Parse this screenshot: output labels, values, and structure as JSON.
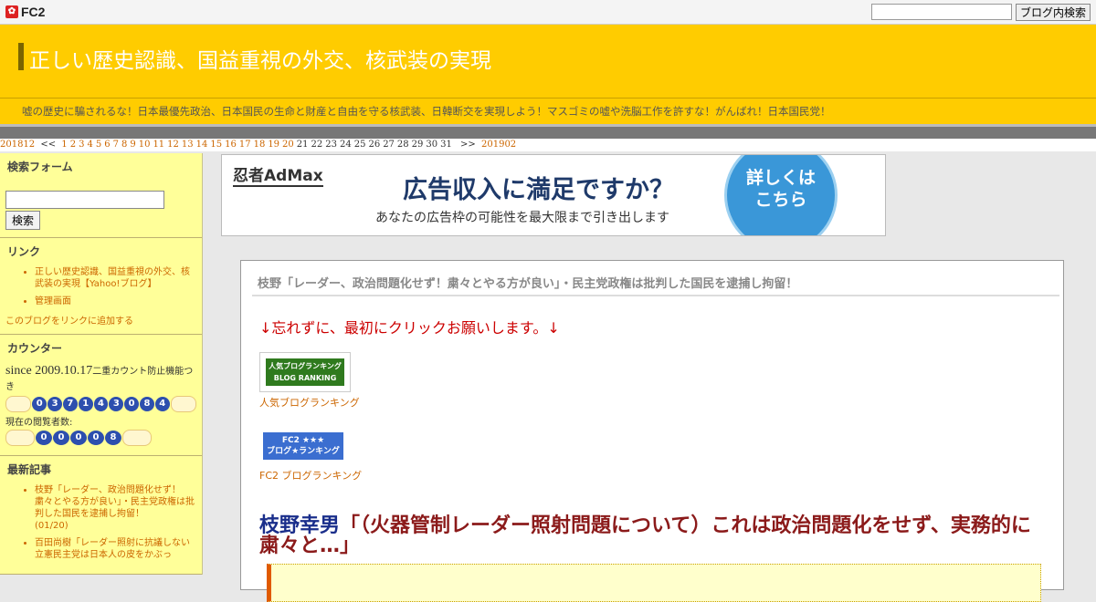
{
  "fc2bar": {
    "logo_text": "FC2",
    "search_placeholder": "",
    "search_button": "ブログ内検索"
  },
  "header": {
    "title": "正しい歴史認識、国益重視の外交、核武装の実現",
    "description": "嘘の歴史に騙されるな！日本最優先政治、日本国民の生命と財産と自由を守る核武装、日韓断交を実現しよう！マスゴミの嘘や洗脳工作を許すな！がんばれ！日本国民党！"
  },
  "calendar": {
    "prev_month": "201812",
    "prev_arrow": "<<",
    "linked_days": [
      "1",
      "2",
      "3",
      "4",
      "5",
      "6",
      "7",
      "8",
      "9",
      "10",
      "11",
      "12",
      "13",
      "14",
      "15",
      "16",
      "17",
      "18",
      "19",
      "20"
    ],
    "plain_days": [
      "21",
      "22",
      "23",
      "24",
      "25",
      "26",
      "27",
      "28",
      "29",
      "30",
      "31"
    ],
    "next_arrow": ">>",
    "next_month": "201902"
  },
  "sidebar": {
    "search": {
      "title": "検索フォーム",
      "button": "検索"
    },
    "links": {
      "title": "リンク",
      "items": [
        "正しい歴史認識、国益重視の外交、核武装の実現【Yahoo!ブログ】",
        "管理画面"
      ],
      "add": "このブログをリンクに追加する"
    },
    "counter": {
      "title": "カウンター",
      "since": "since 2009.10.17",
      "note": "二重カウント防止機能つき",
      "total_digits": [
        "0",
        "3",
        "7",
        "1",
        "4",
        "3",
        "0",
        "8",
        "4"
      ],
      "online_label": "現在の閲覧者数:",
      "online_digits": [
        "0",
        "0",
        "0",
        "0",
        "8"
      ]
    },
    "recent": {
      "title": "最新記事",
      "items": [
        {
          "text": "枝野「レーダー、政治問題化せず！粛々とやる方が良い」・民主党政権は批判した国民を逮捕し拘留！",
          "date": "(01/20)"
        },
        {
          "text": "百田尚樹「レーダー照射に抗議しない立憲民主党は日本人の皮をかぶっ",
          "date": ""
        }
      ]
    }
  },
  "ad": {
    "brand": "忍者AdMax",
    "headline": "広告収入に満足ですか？",
    "sub": "あなたの広告枠の可能性を最大限まで引き出します",
    "cta_line1": "詳しくは",
    "cta_line2": "こちら"
  },
  "entry": {
    "title": "枝野「レーダー、政治問題化せず！粛々とやる方が良い」・民主党政権は批判した国民を逮捕し拘留！",
    "please": "↓忘れずに、最初にクリックお願いします。↓",
    "rank1_banner_l1": "人気ブログランキング",
    "rank1_banner_l2": "BLOG RANKING",
    "rank1_label": "人気ブログランキング",
    "rank2_banner_l1": "FC2 ★★★",
    "rank2_banner_l2": "ブログ★ランキング",
    "rank2_label": "FC2 ブログランキング",
    "headline_name": "枝野幸男",
    "headline_rest": "「（火器管制レーダー照射問題について）これは政治問題化をせず、実務的に粛々と…」"
  },
  "colors": {
    "header": "#ffcc00",
    "sidebar": "#ffff99",
    "link": "#cc6600",
    "accent_red": "#cc0000"
  }
}
